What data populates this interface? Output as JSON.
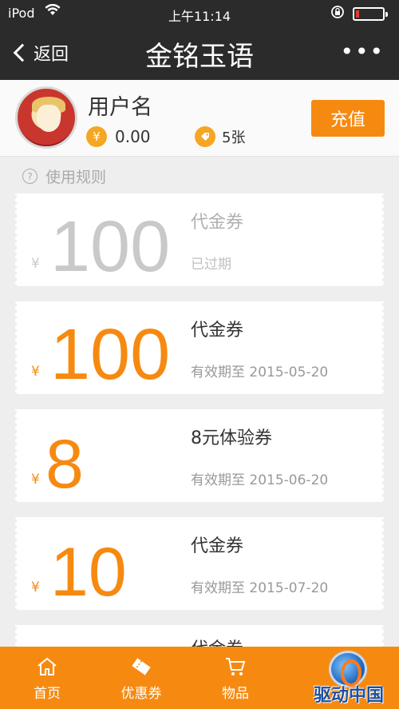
{
  "status_bar": {
    "carrier": "iPod",
    "time": "上午11:14",
    "battery_level": 0.12,
    "battery_color": "#e53a2f"
  },
  "nav": {
    "back_label": "返回",
    "title": "金铭玉语",
    "more_label": "•••"
  },
  "user": {
    "name": "用户名",
    "balance": "0.00",
    "coupon_count": "5张",
    "currency_icon": "¥",
    "recharge_label": "充值"
  },
  "rules": {
    "label": "使用规则",
    "icon": "?"
  },
  "coupons": [
    {
      "currency": "¥",
      "value": "100",
      "title": "代金券",
      "subtitle": "已过期",
      "status": "expired"
    },
    {
      "currency": "¥",
      "value": "100",
      "title": "代金券",
      "subtitle": "有效期至 2015-05-20",
      "status": "active"
    },
    {
      "currency": "¥",
      "value": "8",
      "title": "8元体验券",
      "subtitle": "有效期至 2015-06-20",
      "status": "active"
    },
    {
      "currency": "¥",
      "value": "10",
      "title": "代金券",
      "subtitle": "有效期至 2015-07-20",
      "status": "active"
    },
    {
      "currency": "",
      "value": "",
      "title": "代金券",
      "subtitle": "",
      "status": "active"
    }
  ],
  "tabs": [
    {
      "label": "首页",
      "icon": "home-icon"
    },
    {
      "label": "优惠券",
      "icon": "coupon-icon"
    },
    {
      "label": "物品",
      "icon": "cart-icon"
    }
  ],
  "watermark": {
    "text": "驱动中国"
  },
  "colors": {
    "accent": "#f68a11",
    "nav": "#2b2b2b",
    "expired": "#c9c9c9"
  }
}
